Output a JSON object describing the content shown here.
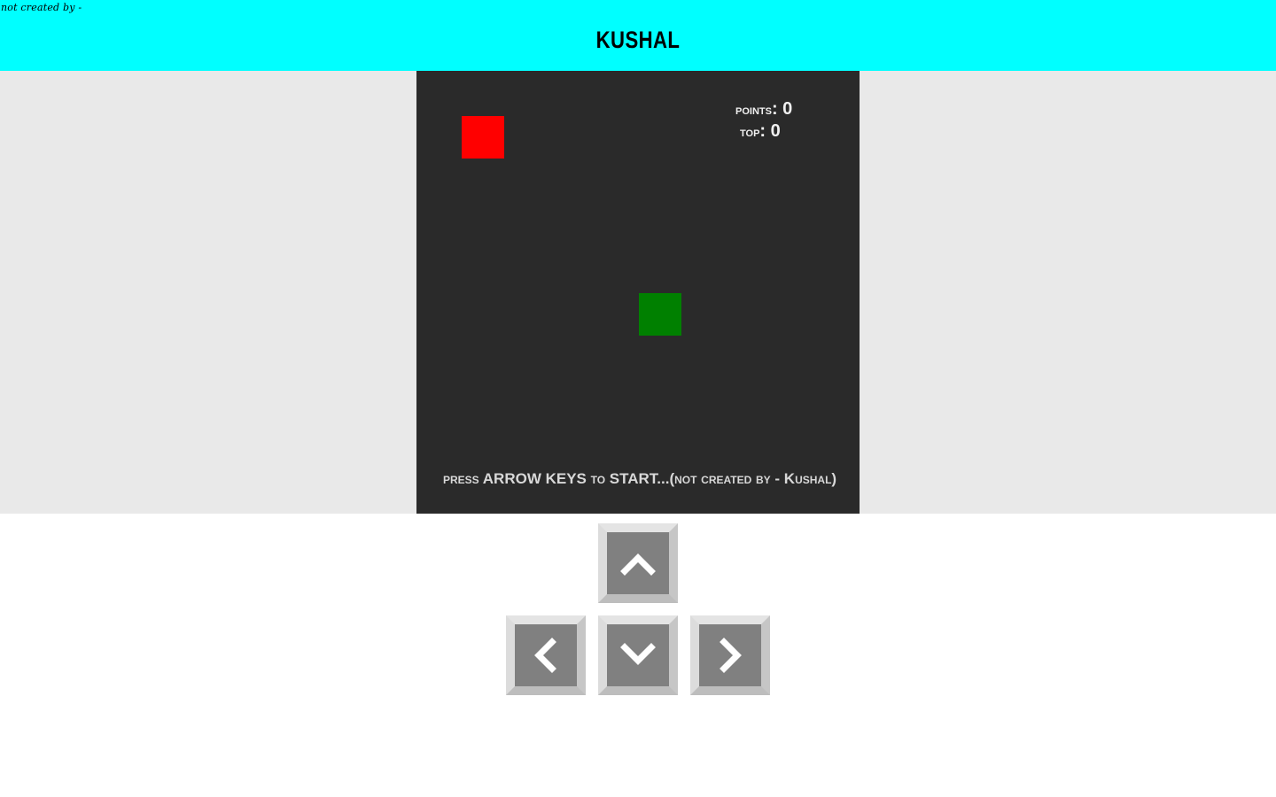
{
  "header": {
    "tagline": "not created by -",
    "brand": "KUSHAL",
    "background": "#00ffff"
  },
  "game": {
    "board_color": "#2a2a2a",
    "page_color": "#e9e9e9",
    "food_color": "#ff0000",
    "snake_color": "#008000",
    "points_label": "points",
    "points_value": "0",
    "top_label": "top",
    "top_value": "0",
    "status_text": "press ARROW KEYS to START...(not created by - Kushal)"
  },
  "controls": {
    "key_color": "#808080",
    "buttons": [
      {
        "name": "up",
        "icon": "chevron-up-icon"
      },
      {
        "name": "left",
        "icon": "chevron-left-icon"
      },
      {
        "name": "down",
        "icon": "chevron-down-icon"
      },
      {
        "name": "right",
        "icon": "chevron-right-icon"
      }
    ]
  }
}
